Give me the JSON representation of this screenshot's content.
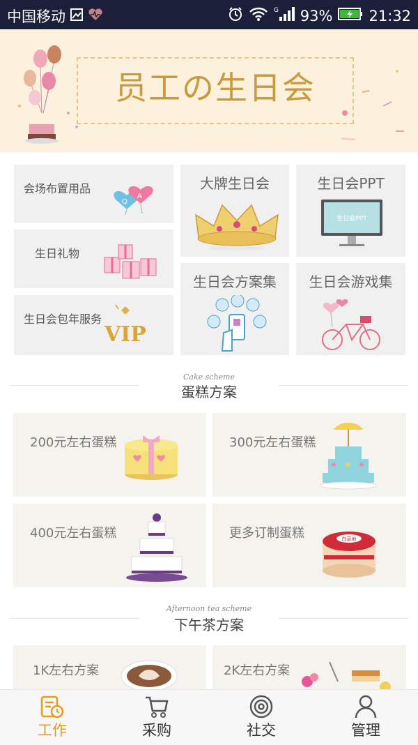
{
  "status_bar": {
    "carrier": "中国移动",
    "signal_label": "G",
    "battery": "93%",
    "time": "21:32"
  },
  "banner": {
    "title": "员工の生日会"
  },
  "grid": {
    "venue_supplies": "会场布置用品",
    "birthday_gift": "生日礼物",
    "annual_service": "生日会包年服务",
    "big_brand": "大牌生日会",
    "ppt": "生日会PPT",
    "ppt_screen_text": "生日会PPT",
    "plans": "生日会方案集",
    "games": "生日会游戏集",
    "balloon_letters": [
      "Q",
      "A"
    ],
    "vip_text": "VIP"
  },
  "cake_section": {
    "script": "Cake scheme",
    "title": "蛋糕方案",
    "items": [
      {
        "label": "200元左右蛋糕"
      },
      {
        "label": "300元左右蛋糕"
      },
      {
        "label": "400元左右蛋糕"
      },
      {
        "label": "更多订制蛋糕"
      }
    ],
    "cake_brand": "白草地"
  },
  "tea_section": {
    "script": "Afternoon tea scheme",
    "title": "下午茶方案",
    "items": [
      {
        "label": "1K左右方案"
      },
      {
        "label": "2K左右方案"
      }
    ]
  },
  "tab_bar": {
    "tabs": [
      {
        "label": "工作",
        "icon": "clipboard-clock-icon",
        "active": true
      },
      {
        "label": "采购",
        "icon": "shopping-cart-icon",
        "active": false
      },
      {
        "label": "社交",
        "icon": "target-icon",
        "active": false
      },
      {
        "label": "管理",
        "icon": "person-icon",
        "active": false
      }
    ]
  },
  "colors": {
    "status_bg": "#1b1f3a",
    "banner_bg": "#fbf1dc",
    "accent": "#e69a1e",
    "banner_text": "#c99a3e"
  }
}
